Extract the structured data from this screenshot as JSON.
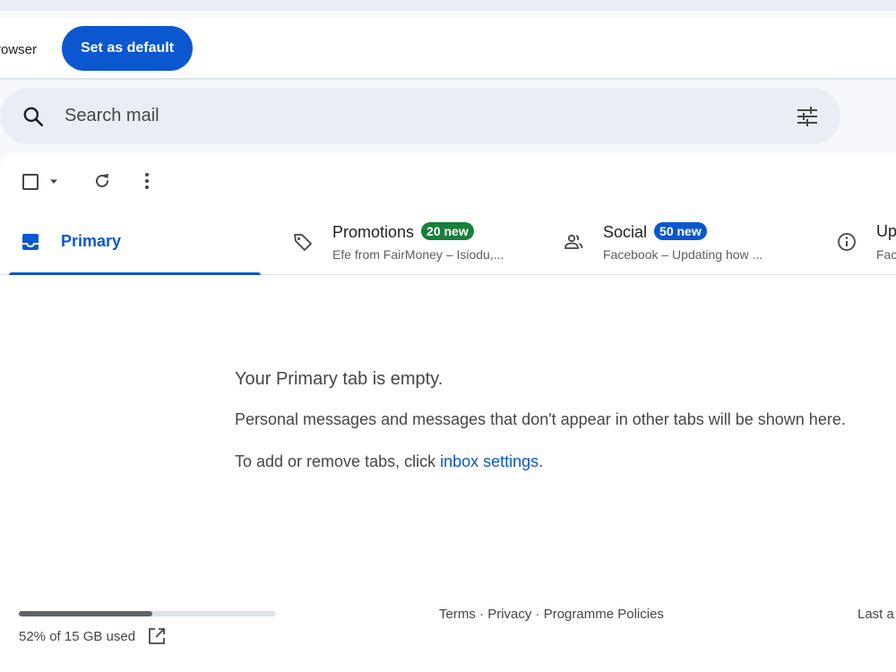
{
  "banner": {
    "text": "rowser",
    "button_label": "Set as default"
  },
  "search": {
    "placeholder": "Search mail",
    "icon": "search-icon",
    "options_icon": "sliders-icon"
  },
  "toolbar": {
    "icons": [
      "checkbox-icon",
      "caret-down-icon",
      "refresh-icon",
      "more-vert-icon"
    ]
  },
  "tabs": [
    {
      "label": "Primary",
      "selected": true,
      "icon": "inbox-icon"
    },
    {
      "label": "Promotions",
      "badge": "20 new",
      "badge_color": "#188038",
      "snippet": "Efe from FairMoney – Isiodu,...",
      "icon": "tag-icon"
    },
    {
      "label": "Social",
      "badge": "50 new",
      "badge_color": "#0b57d0",
      "snippet": "Facebook – Updating how ...",
      "icon": "people-icon"
    },
    {
      "label": "Up",
      "snippet": "Fac",
      "icon": "info-icon"
    }
  ],
  "empty_state": {
    "title": "Your Primary tab is empty.",
    "line1": "Personal messages and messages that don't appear in other tabs will be shown here.",
    "line2_prefix": "To add or remove tabs, click ",
    "line2_link": "inbox settings",
    "line2_suffix": "."
  },
  "storage": {
    "text": "52% of 15 GB used",
    "fraction": 0.52
  },
  "footer": {
    "terms": "Terms",
    "privacy": "Privacy",
    "policies": "Programme Policies",
    "separator": " · ",
    "last_account": "Last a"
  },
  "colors": {
    "accent": "#0b57d0",
    "promotions_badge": "#188038",
    "social_badge": "#0b57d0"
  }
}
